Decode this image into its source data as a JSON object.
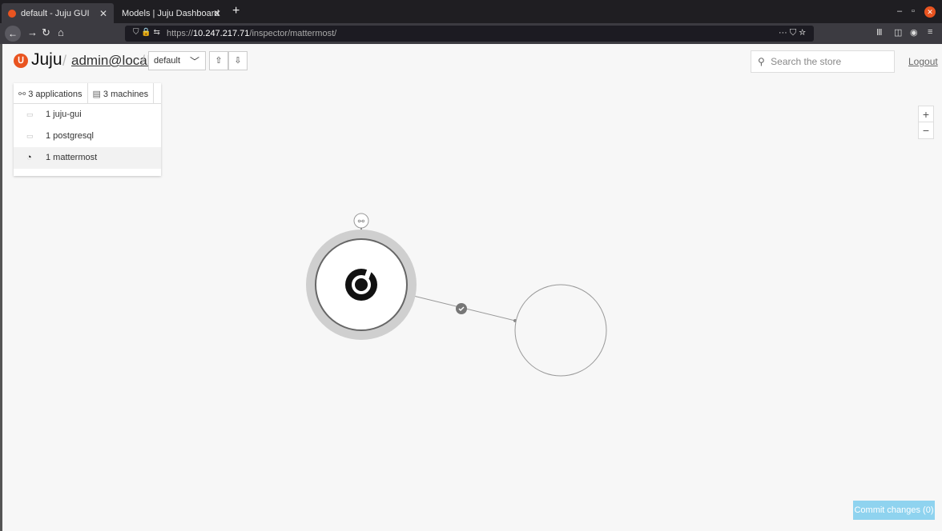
{
  "browser": {
    "tabs": [
      {
        "title": "default - Juju GUI",
        "active": true
      },
      {
        "title": "Models | Juju Dashboard",
        "active": false
      }
    ],
    "url_prefix": "https://",
    "url_host": "10.247.217.71",
    "url_path": "/inspector/mattermost/",
    "url_menu": "···",
    "new_tab": "+"
  },
  "header": {
    "logo_text": "Juju",
    "user": "admin@local",
    "model": "default",
    "search_placeholder": "Search the store",
    "logout": "Logout"
  },
  "panel": {
    "tabs": [
      {
        "label": "3 applications",
        "icon": "relation-icon"
      },
      {
        "label": "3 machines",
        "icon": "machine-icon"
      }
    ],
    "apps": [
      {
        "label": "1 juju-gui",
        "icon": "app-icon",
        "selected": false
      },
      {
        "label": "1 postgresql",
        "icon": "app-icon",
        "selected": false
      },
      {
        "label": "1 mattermost",
        "icon": "mattermost-icon",
        "selected": true
      }
    ]
  },
  "zoom": {
    "in": "+",
    "out": "−"
  },
  "commit_label": "Commit changes (0)",
  "colors": {
    "accent": "#e95420",
    "commit": "#8fd3ef"
  }
}
